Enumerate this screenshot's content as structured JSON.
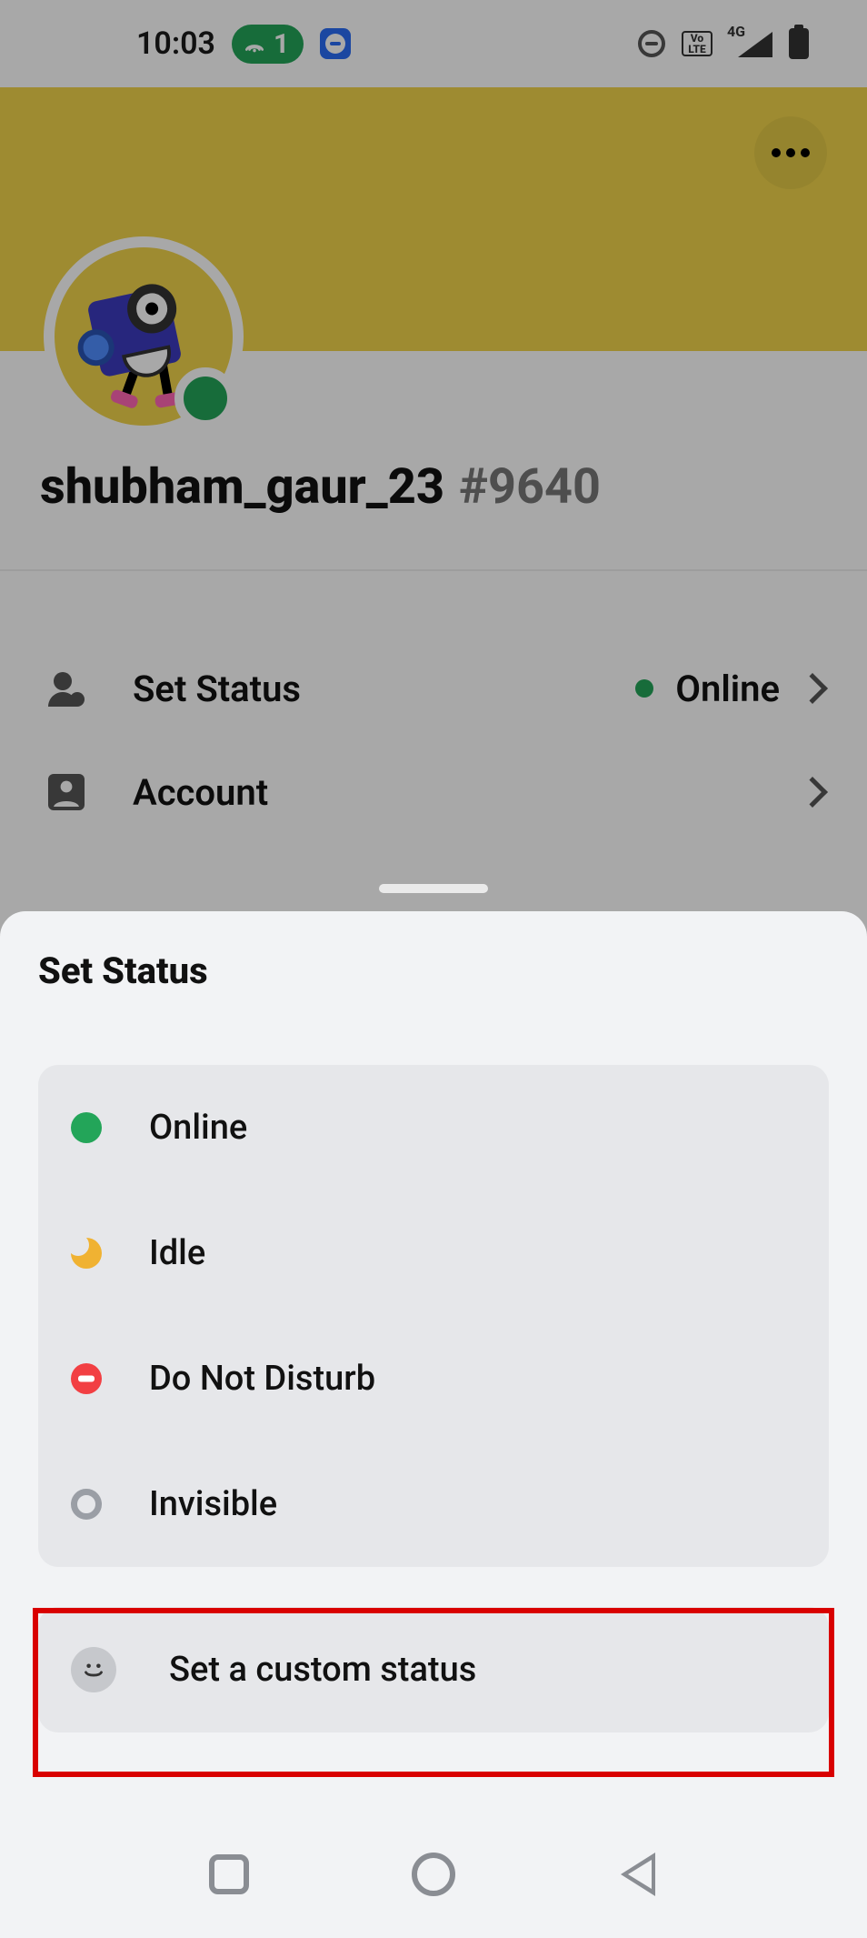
{
  "statusbar": {
    "time": "10:03",
    "hotspot_count": "1",
    "net_label": "4G",
    "volte_top": "Vo",
    "volte_bot": "LTE"
  },
  "profile": {
    "username": "shubham_gaur_23",
    "tag": "#9640",
    "rows": {
      "set_status": {
        "label": "Set Status",
        "value": "Online"
      },
      "account": {
        "label": "Account"
      }
    }
  },
  "sheet": {
    "title": "Set Status",
    "options": {
      "online": {
        "label": "Online"
      },
      "idle": {
        "label": "Idle"
      },
      "dnd": {
        "label": "Do Not Disturb"
      },
      "invisible": {
        "label": "Invisible"
      }
    },
    "custom": {
      "label": "Set a custom status"
    }
  }
}
